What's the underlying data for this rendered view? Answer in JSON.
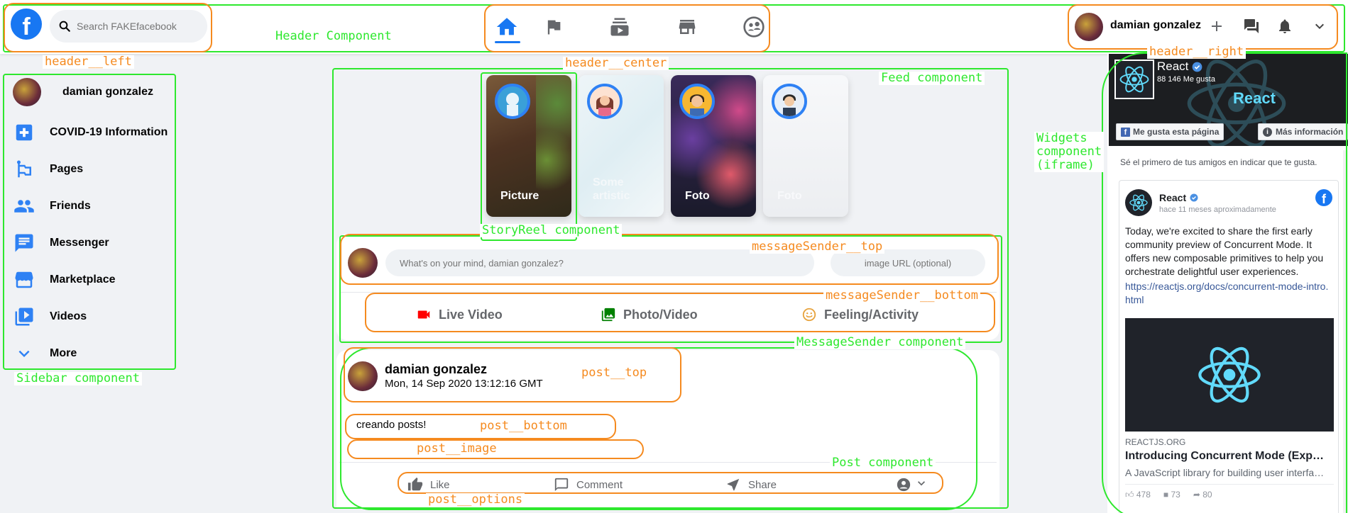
{
  "header": {
    "logo": "f",
    "search_placeholder": "Search FAKEfacebook",
    "user_name": "damian gonzalez",
    "nav_icons": [
      "home-icon",
      "flag-icon",
      "subscriptions-icon",
      "storefront-icon",
      "supervised-user-icon"
    ],
    "right_icons": [
      "add-icon",
      "forum-icon",
      "notifications-active-icon",
      "expand-more-icon"
    ],
    "accent": "#1877f2"
  },
  "sidebar": {
    "user_name": "damian gonzalez",
    "items": [
      {
        "label": "COVID-19 Information",
        "icon": "local-hospital-icon"
      },
      {
        "label": "Pages",
        "icon": "emoji-flags-icon"
      },
      {
        "label": "Friends",
        "icon": "people-icon"
      },
      {
        "label": "Messenger",
        "icon": "chat-icon"
      },
      {
        "label": "Marketplace",
        "icon": "storefront-icon"
      },
      {
        "label": "Videos",
        "icon": "video-library-icon"
      },
      {
        "label": "More",
        "icon": "expand-more-icon"
      }
    ]
  },
  "stories": [
    {
      "title": "Picture"
    },
    {
      "title": "Some artistic"
    },
    {
      "title": "Foto"
    },
    {
      "title": "Foto"
    }
  ],
  "message_sender": {
    "placeholder": "What's on your mind, damian gonzalez?",
    "image_placeholder": "image URL (optional)",
    "options": [
      {
        "label": "Live Video",
        "icon": "videocam-icon",
        "color": "#ff0000"
      },
      {
        "label": "Photo/Video",
        "icon": "photo-library-icon",
        "color": "#008000"
      },
      {
        "label": "Feeling/Activity",
        "icon": "insert-emoticon-icon",
        "color": "#e7a33e"
      }
    ]
  },
  "post": {
    "username": "damian gonzalez",
    "timestamp": "Mon, 14 Sep 2020 13:12:16 GMT",
    "message": "creando posts!",
    "options": [
      "Like",
      "Comment",
      "Share"
    ]
  },
  "widget": {
    "page_name": "React",
    "likes": "88 146 Me gusta",
    "cover_title": "React",
    "like_page_button": "Me gusta esta página",
    "more_info_button": "Más información",
    "friends_note": "Sé el primero de tus amigos en indicar que te gusta.",
    "post": {
      "author": "React",
      "time": "hace 11 meses aproximadamente",
      "text": "Today, we're excited to share the first early community preview of Concurrent Mode. It offers new composable primitives to help you orchestrate delightful user experiences.",
      "link": "https://reactjs.org/docs/concurrent-mode-intro.html",
      "domain": "REACTJS.ORG",
      "headline": "Introducing Concurrent Mode (Exp…",
      "description": "A JavaScript library for building user interfa…",
      "reactions": "478",
      "comments": "73",
      "shares": "80"
    }
  },
  "annotations": {
    "header_component": "Header Component",
    "header_left": "header__left",
    "header_center": "header__center",
    "header_right": "header__right",
    "feed_component": "Feed component",
    "sidebar_component": "Sidebar component",
    "widgets_component": "Widgets\ncomponent\n(iframe)",
    "storyreel_component": "StoryReel component",
    "ms_top": "messageSender__top",
    "ms_bottom": "messageSender__bottom",
    "ms_component": "MessageSender component",
    "post_top": "post__top",
    "post_bottom": "post__bottom",
    "post_image": "post__image",
    "post_component": "Post component",
    "post_options": "post__options"
  },
  "colors": {
    "annotation_green": "#2ee82e",
    "annotation_orange": "#f58a1f",
    "background": "#f0f2f5",
    "react_cyan": "#61dafb"
  }
}
